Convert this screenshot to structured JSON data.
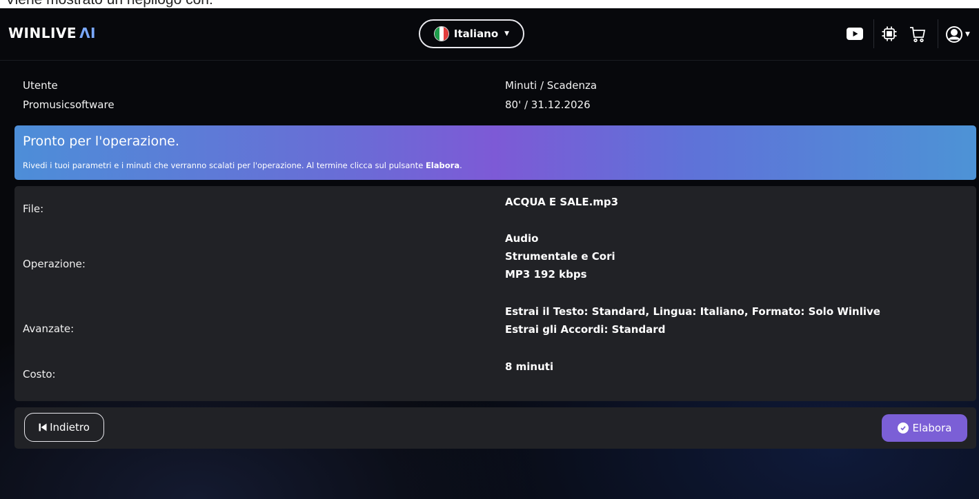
{
  "caption": "Viene mostrato un riepilogo con:",
  "header": {
    "logo_text": "WINLIVE",
    "logo_accent": "ΛI",
    "language_label": "Italiano",
    "icons": [
      "youtube-icon",
      "chip-icon",
      "cart-icon",
      "user-icon"
    ]
  },
  "account": {
    "user_label": "Utente",
    "user_value": "Promusicsoftware",
    "minutes_label": "Minuti / Scadenza",
    "minutes_value": "80' / 31.12.2026"
  },
  "banner": {
    "title": "Pronto per l'operazione.",
    "text_prefix": "Rivedi i tuoi parametri e i minuti che verranno scalati per l'operazione. Al termine clicca sul pulsante ",
    "text_bold": "Elabora",
    "text_suffix": "."
  },
  "summary": {
    "file_label": "File:",
    "file_value": "ACQUA E SALE.mp3",
    "operation_label": "Operazione:",
    "operation_lines": [
      "Audio",
      "Strumentale e Cori",
      "MP3 192 kbps"
    ],
    "advanced_label": "Avanzate:",
    "advanced_lines": [
      "Estrai il Testo: Standard, Lingua: Italiano, Formato: Solo Winlive",
      "Estrai gli Accordi: Standard"
    ],
    "cost_label": "Costo:",
    "cost_value": "8 minuti"
  },
  "footer": {
    "back_label": "Indietro",
    "submit_label": "Elabora"
  },
  "colors": {
    "accent": "#7b5fd6",
    "logo_accent": "#7aa8ff",
    "card_bg": "#212226",
    "page_bg": "#07080c"
  }
}
